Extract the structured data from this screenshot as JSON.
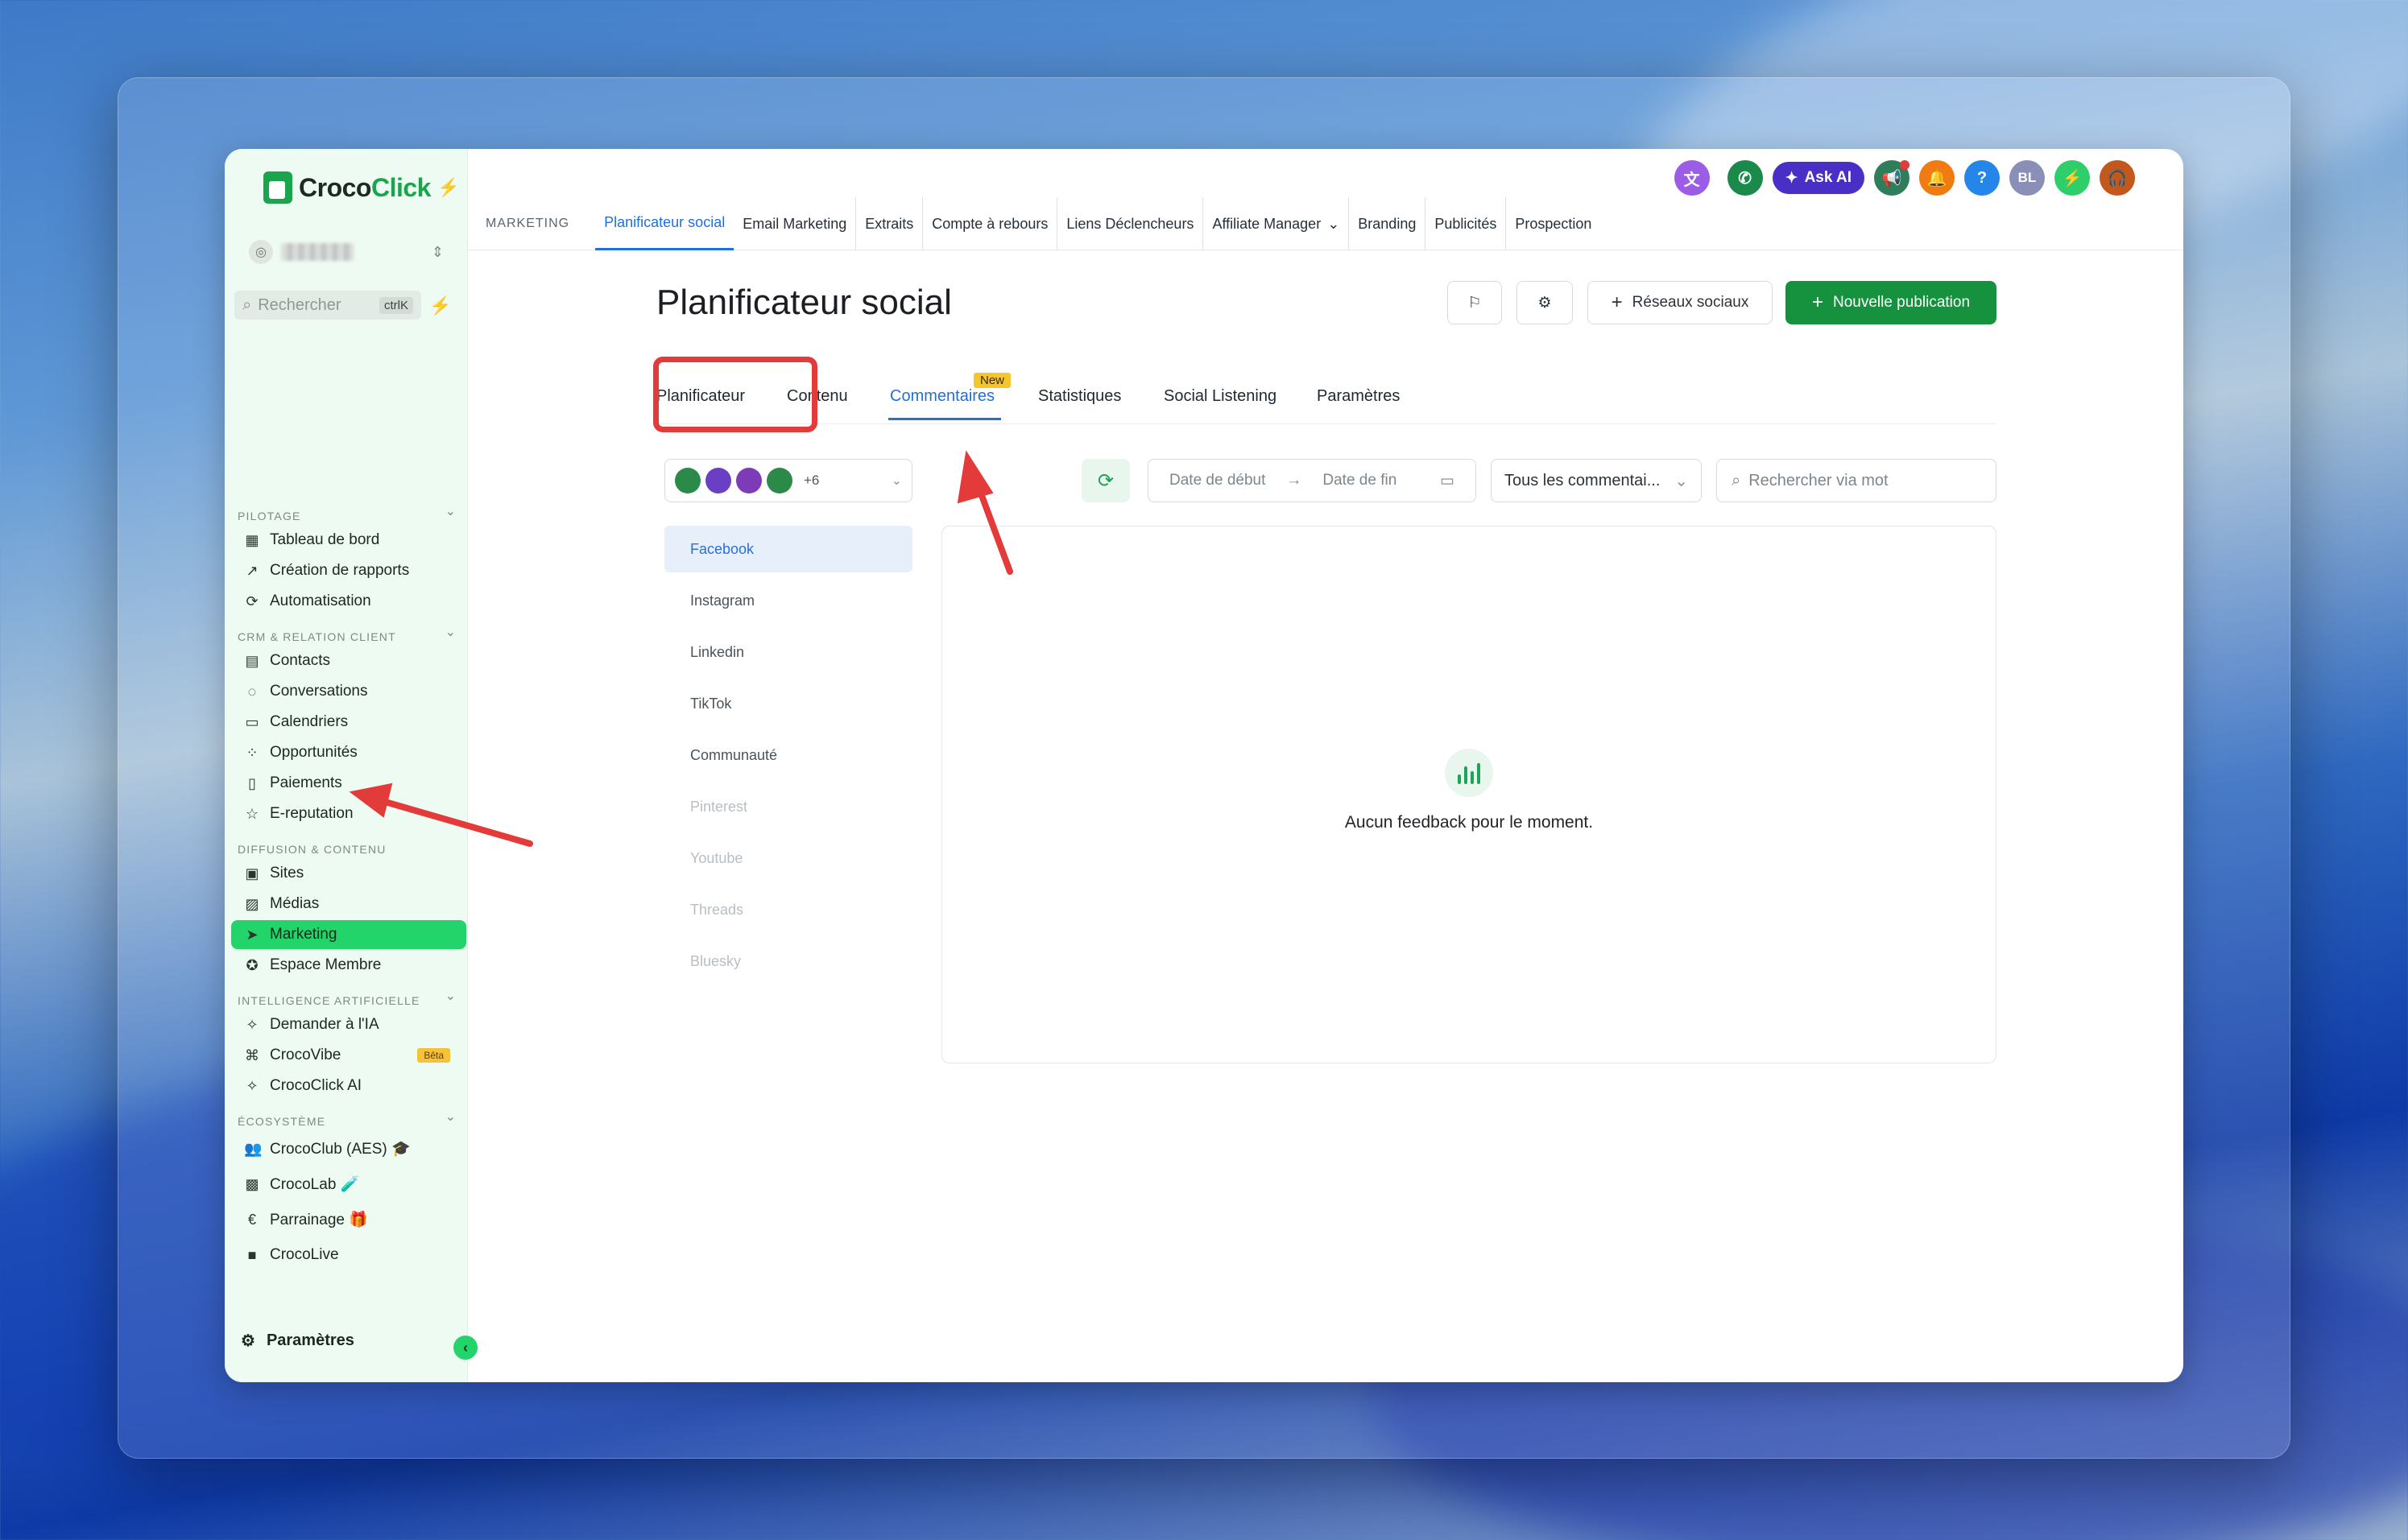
{
  "sidebar": {
    "brand": {
      "text_a": "Croco",
      "text_b": "Click"
    },
    "search": {
      "placeholder": "Rechercher",
      "shortcut": "ctrlK"
    },
    "sections": [
      {
        "label": "PILOTAGE"
      },
      {
        "label": "CRM & RELATION CLIENT"
      },
      {
        "label": "DIFFUSION & CONTENU"
      },
      {
        "label": "INTELLIGENCE ARTIFICIELLE"
      },
      {
        "label": "ÉCOSYSTÈME"
      }
    ],
    "items": [
      {
        "label": "Tableau de bord",
        "icon": "dashboard-icon"
      },
      {
        "label": "Création de rapports",
        "icon": "trend-icon"
      },
      {
        "label": "Automatisation",
        "icon": "automation-icon"
      },
      {
        "label": "Contacts",
        "icon": "contacts-icon"
      },
      {
        "label": "Conversations",
        "icon": "chat-icon"
      },
      {
        "label": "Calendriers",
        "icon": "calendar-icon"
      },
      {
        "label": "Opportunités",
        "icon": "pipeline-icon"
      },
      {
        "label": "Paiements",
        "icon": "receipt-icon"
      },
      {
        "label": "E-reputation",
        "icon": "star-icon"
      },
      {
        "label": "Sites",
        "icon": "sites-icon"
      },
      {
        "label": "Médias",
        "icon": "image-icon"
      },
      {
        "label": "Marketing",
        "icon": "send-icon"
      },
      {
        "label": "Espace Membre",
        "icon": "award-icon"
      },
      {
        "label": "Demander à l'IA",
        "icon": "sparkle-icon"
      },
      {
        "label": "CrocoVibe",
        "icon": "vibe-icon",
        "badge": "Bêta"
      },
      {
        "label": "CrocoClick AI",
        "icon": "sparkle-icon"
      },
      {
        "label": "CrocoClub (AES) 🎓",
        "icon": "users-icon"
      },
      {
        "label": "CrocoLab 🧪",
        "icon": "book-icon"
      },
      {
        "label": "Parrainage 🎁",
        "icon": "euro-icon"
      },
      {
        "label": "CrocoLive",
        "icon": "video-icon"
      }
    ],
    "settings_label": "Paramètres"
  },
  "topbar": {
    "ask_ai_label": "Ask AI",
    "user_initials": "BL",
    "help_label": "?"
  },
  "topnav": {
    "section_label": "MARKETING",
    "items": [
      "Planificateur social",
      "Email Marketing",
      "Extraits",
      "Compte à rebours",
      "Liens Déclencheurs",
      "Affiliate Manager",
      "Branding",
      "Publicités",
      "Prospection"
    ]
  },
  "page": {
    "title": "Planificateur social",
    "buttons": {
      "networks": "Réseaux sociaux",
      "new_post": "Nouvelle publication"
    },
    "tabs": [
      "Planificateur",
      "Contenu",
      "Commentaires",
      "Statistiques",
      "Social Listening",
      "Paramètres"
    ],
    "new_badge": "New",
    "filters": {
      "accounts_more": "+6",
      "date_start": "Date de début",
      "date_end": "Date de fin",
      "comment_filter": "Tous les commentai...",
      "keyword_placeholder": "Rechercher via mot"
    },
    "networks": [
      "Facebook",
      "Instagram",
      "Linkedin",
      "TikTok",
      "Communauté",
      "Pinterest",
      "Youtube",
      "Threads",
      "Bluesky"
    ],
    "empty_state": "Aucun feedback pour le moment."
  },
  "colors": {
    "accent": "#22d46a",
    "primary_button": "#16923f",
    "link_blue": "#1f6fde",
    "annotation_red": "#e33a3a"
  }
}
